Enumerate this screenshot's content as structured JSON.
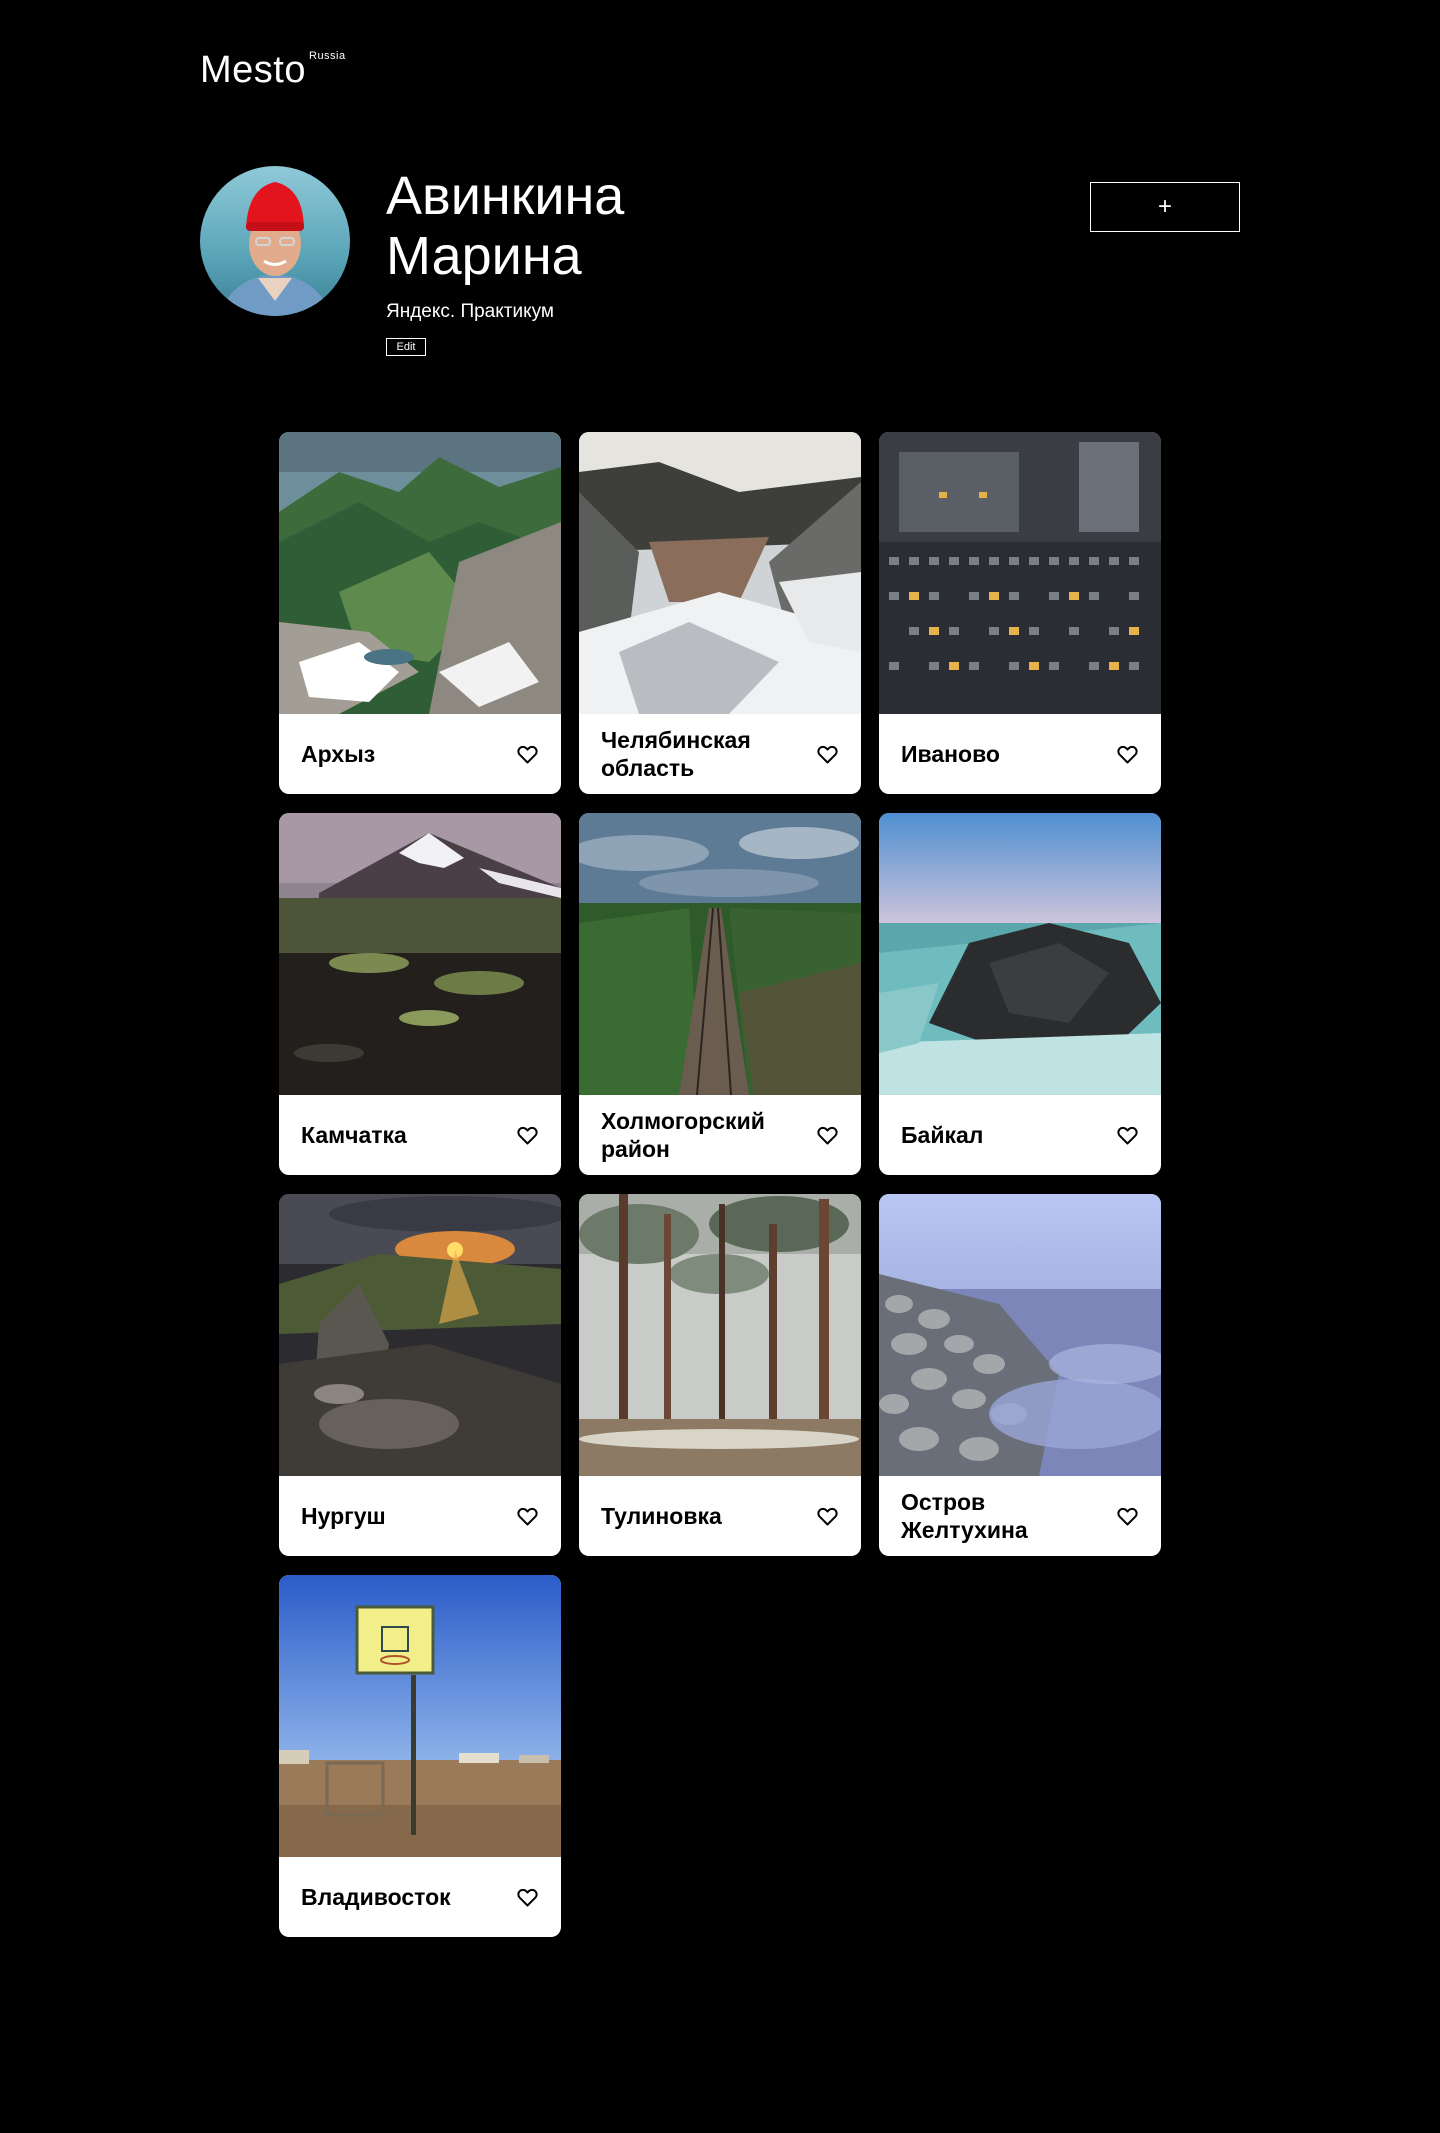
{
  "header": {
    "logo": "Mesto",
    "logo_sup": "Russia"
  },
  "profile": {
    "name": "Авинкина Марина",
    "about": "Яндекс. Практикум",
    "edit_label": "Edit",
    "add_label": "+"
  },
  "cards": [
    {
      "title": "Архыз"
    },
    {
      "title": "Челябинская область"
    },
    {
      "title": "Иваново"
    },
    {
      "title": "Камчатка"
    },
    {
      "title": "Холмогорский район"
    },
    {
      "title": "Байкал"
    },
    {
      "title": "Нургуш"
    },
    {
      "title": "Тулиновка"
    },
    {
      "title": "Остров Желтухина"
    },
    {
      "title": "Владивосток"
    }
  ],
  "colors": {
    "background": "#000000",
    "card": "#ffffff",
    "text": "#ffffff",
    "card_text": "#000000"
  },
  "icons": {
    "like": "heart-outline-icon",
    "add": "plus-icon"
  }
}
